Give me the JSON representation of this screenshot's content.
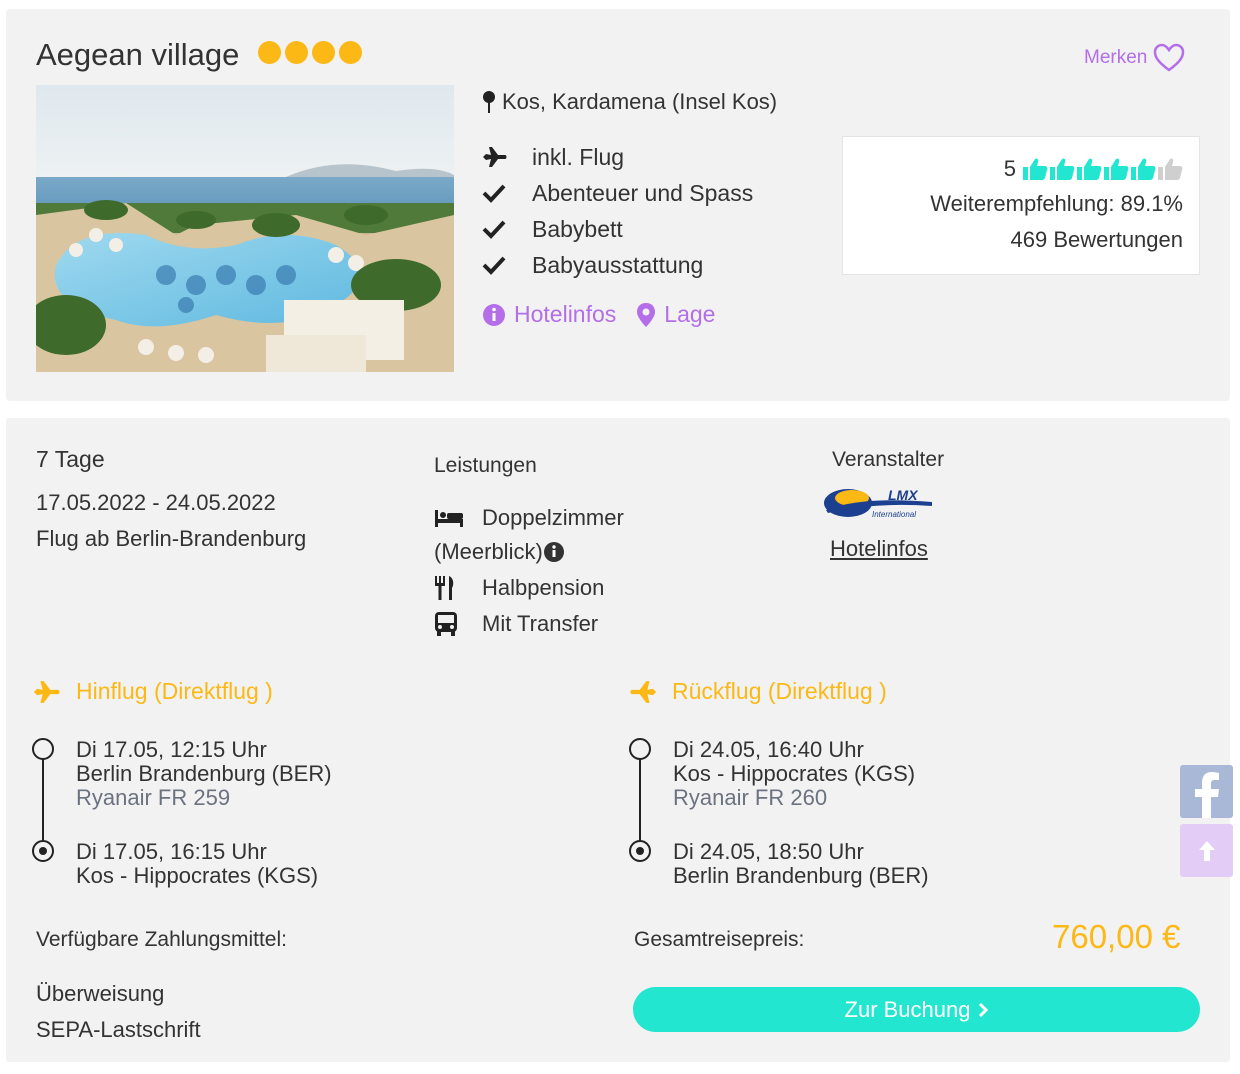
{
  "hotel": {
    "name": "Aegean village",
    "star_count": 4,
    "star_color": "#fcb814",
    "merken_label": "Merken",
    "location": "Kos, Kardamena (Insel Kos)",
    "features": [
      {
        "icon": "plane-icon",
        "label": "inkl. Flug"
      },
      {
        "icon": "check-icon",
        "label": "Abenteuer und Spass"
      },
      {
        "icon": "check-icon",
        "label": "Babybett"
      },
      {
        "icon": "check-icon",
        "label": "Babyausstattung"
      }
    ],
    "links": {
      "hotelinfos": "Hotelinfos",
      "lage": "Lage"
    },
    "rating": {
      "score": "5",
      "thumbs_filled": 5,
      "thumbs_total": 6,
      "thumb_color": "#22e6cf",
      "recommendation": "Weiterempfehlung: 89.1%",
      "reviews": "469 Bewertungen"
    }
  },
  "trip": {
    "duration": "7 Tage",
    "dates": "17.05.2022 - 24.05.2022",
    "departure": "Flug ab Berlin-Brandenburg"
  },
  "leistungen": {
    "title": "Leistungen",
    "items": [
      {
        "icon": "bed-icon",
        "label": "Doppelzimmer",
        "extra": "(Meerblick)"
      },
      {
        "icon": "utensils-icon",
        "label": "Halbpension"
      },
      {
        "icon": "bus-icon",
        "label": "Mit Transfer"
      }
    ]
  },
  "veranstalter": {
    "title": "Veranstalter",
    "logo_text": "LMX",
    "logo_sub": "International",
    "link": "Hotelinfos"
  },
  "hinflug": {
    "title": "Hinflug (Direktflug )",
    "dep_time": "Di 17.05, 12:15 Uhr",
    "dep_airport": "Berlin Brandenburg (BER)",
    "carrier": "Ryanair FR 259",
    "arr_time": "Di 17.05, 16:15 Uhr",
    "arr_airport": "Kos - Hippocrates (KGS)"
  },
  "rueckflug": {
    "title": "Rückflug (Direktflug )",
    "dep_time": "Di 24.05, 16:40 Uhr",
    "dep_airport": "Kos - Hippocrates (KGS)",
    "carrier": "Ryanair FR 260",
    "arr_time": "Di 24.05, 18:50 Uhr",
    "arr_airport": "Berlin Brandenburg (BER)"
  },
  "payment": {
    "title": "Verfügbare Zahlungsmittel:",
    "methods": [
      "Überweisung",
      "SEPA-Lastschrift"
    ]
  },
  "total": {
    "label": "Gesamtreisepreis:",
    "price": "760,00 €",
    "button": "Zur Buchung"
  },
  "colors": {
    "accent_purple": "#b36ee8",
    "accent_orange": "#fcb814",
    "accent_teal": "#22e6cf"
  }
}
